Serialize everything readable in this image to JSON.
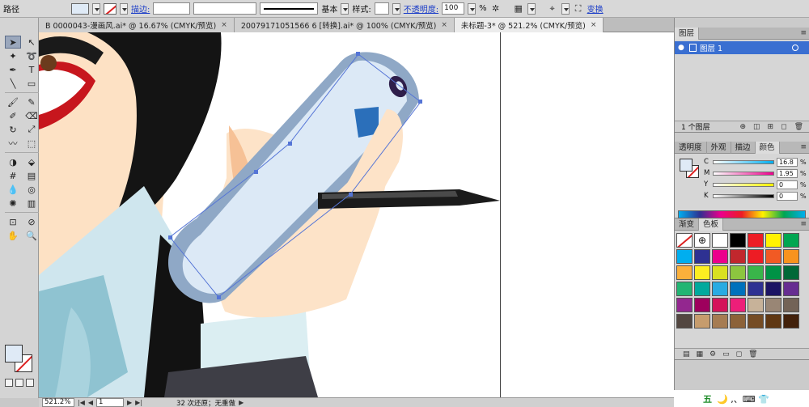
{
  "control_bar": {
    "path_label": "路径",
    "stroke_label": "描边:",
    "stroke_style": "基本",
    "style_label": "样式:",
    "opacity_label": "不透明度:",
    "opacity_value": "100",
    "percent": "%",
    "transform_label": "变换"
  },
  "tabs": [
    {
      "label": "B 0000043-漫画风.ai* @ 16.67% (CMYK/预览)",
      "close": "×"
    },
    {
      "label": "20079171051566 6 [转换].ai* @ 100% (CMYK/预览)",
      "close": "×"
    },
    {
      "label": "未标题-3* @ 521.2% (CMYK/预览)",
      "close": "×"
    }
  ],
  "tools": [
    "selection-icon",
    "direct-selection-icon",
    "magic-wand-icon",
    "lasso-icon",
    "pen-icon",
    "type-icon",
    "line-icon",
    "rectangle-icon",
    "paintbrush-icon",
    "pencil-icon",
    "blob-brush-icon",
    "eraser-icon",
    "rotate-icon",
    "scale-icon",
    "warp-icon",
    "free-transform-icon",
    "shape-builder-icon",
    "perspective-icon",
    "mesh-icon",
    "gradient-icon",
    "eyedropper-icon",
    "blend-icon",
    "symbol-sprayer-icon",
    "column-graph-icon",
    "artboard-icon",
    "slice-icon",
    "hand-icon",
    "zoom-icon"
  ],
  "layers_panel": {
    "tab": "图层",
    "layer_name": "图层 1",
    "footer_count": "1 个图层"
  },
  "color_panel": {
    "tabs": [
      "透明度",
      "外观",
      "描边",
      "颜色"
    ],
    "sliders": [
      {
        "label": "C",
        "value": "16.8"
      },
      {
        "label": "M",
        "value": "1.95"
      },
      {
        "label": "Y",
        "value": "0"
      },
      {
        "label": "K",
        "value": "0"
      }
    ],
    "percent": "%"
  },
  "swatches_panel": {
    "tabs": [
      "渐变",
      "色板"
    ],
    "colors": [
      "#000000",
      "#ed1c24",
      "#fff200",
      "#00a651",
      "#00aeef",
      "#2e3192",
      "#ec008c",
      "#c1272d",
      "#ed1c24",
      "#f15a24",
      "#f7931e",
      "#fbb03b",
      "#fcee21",
      "#d9e021",
      "#8cc63f",
      "#39b54a",
      "#009245",
      "#006837",
      "#22b573",
      "#00a99d",
      "#29abe2",
      "#0071bc",
      "#2e3192",
      "#1b1464",
      "#662d91",
      "#93278f",
      "#9e005d",
      "#d4145a",
      "#ed1e79",
      "#c7b299",
      "#998675",
      "#736357",
      "#534741",
      "#c69c6d",
      "#a67c52",
      "#8c6239",
      "#754c24",
      "#603813",
      "#42210b"
    ]
  },
  "status": {
    "zoom": "521.2%",
    "page": "1",
    "undo_text": "32 次还原；无重做"
  },
  "tray": {
    "ime": "五",
    "tray_icons": "🌙 ,、⌨ 👕"
  }
}
